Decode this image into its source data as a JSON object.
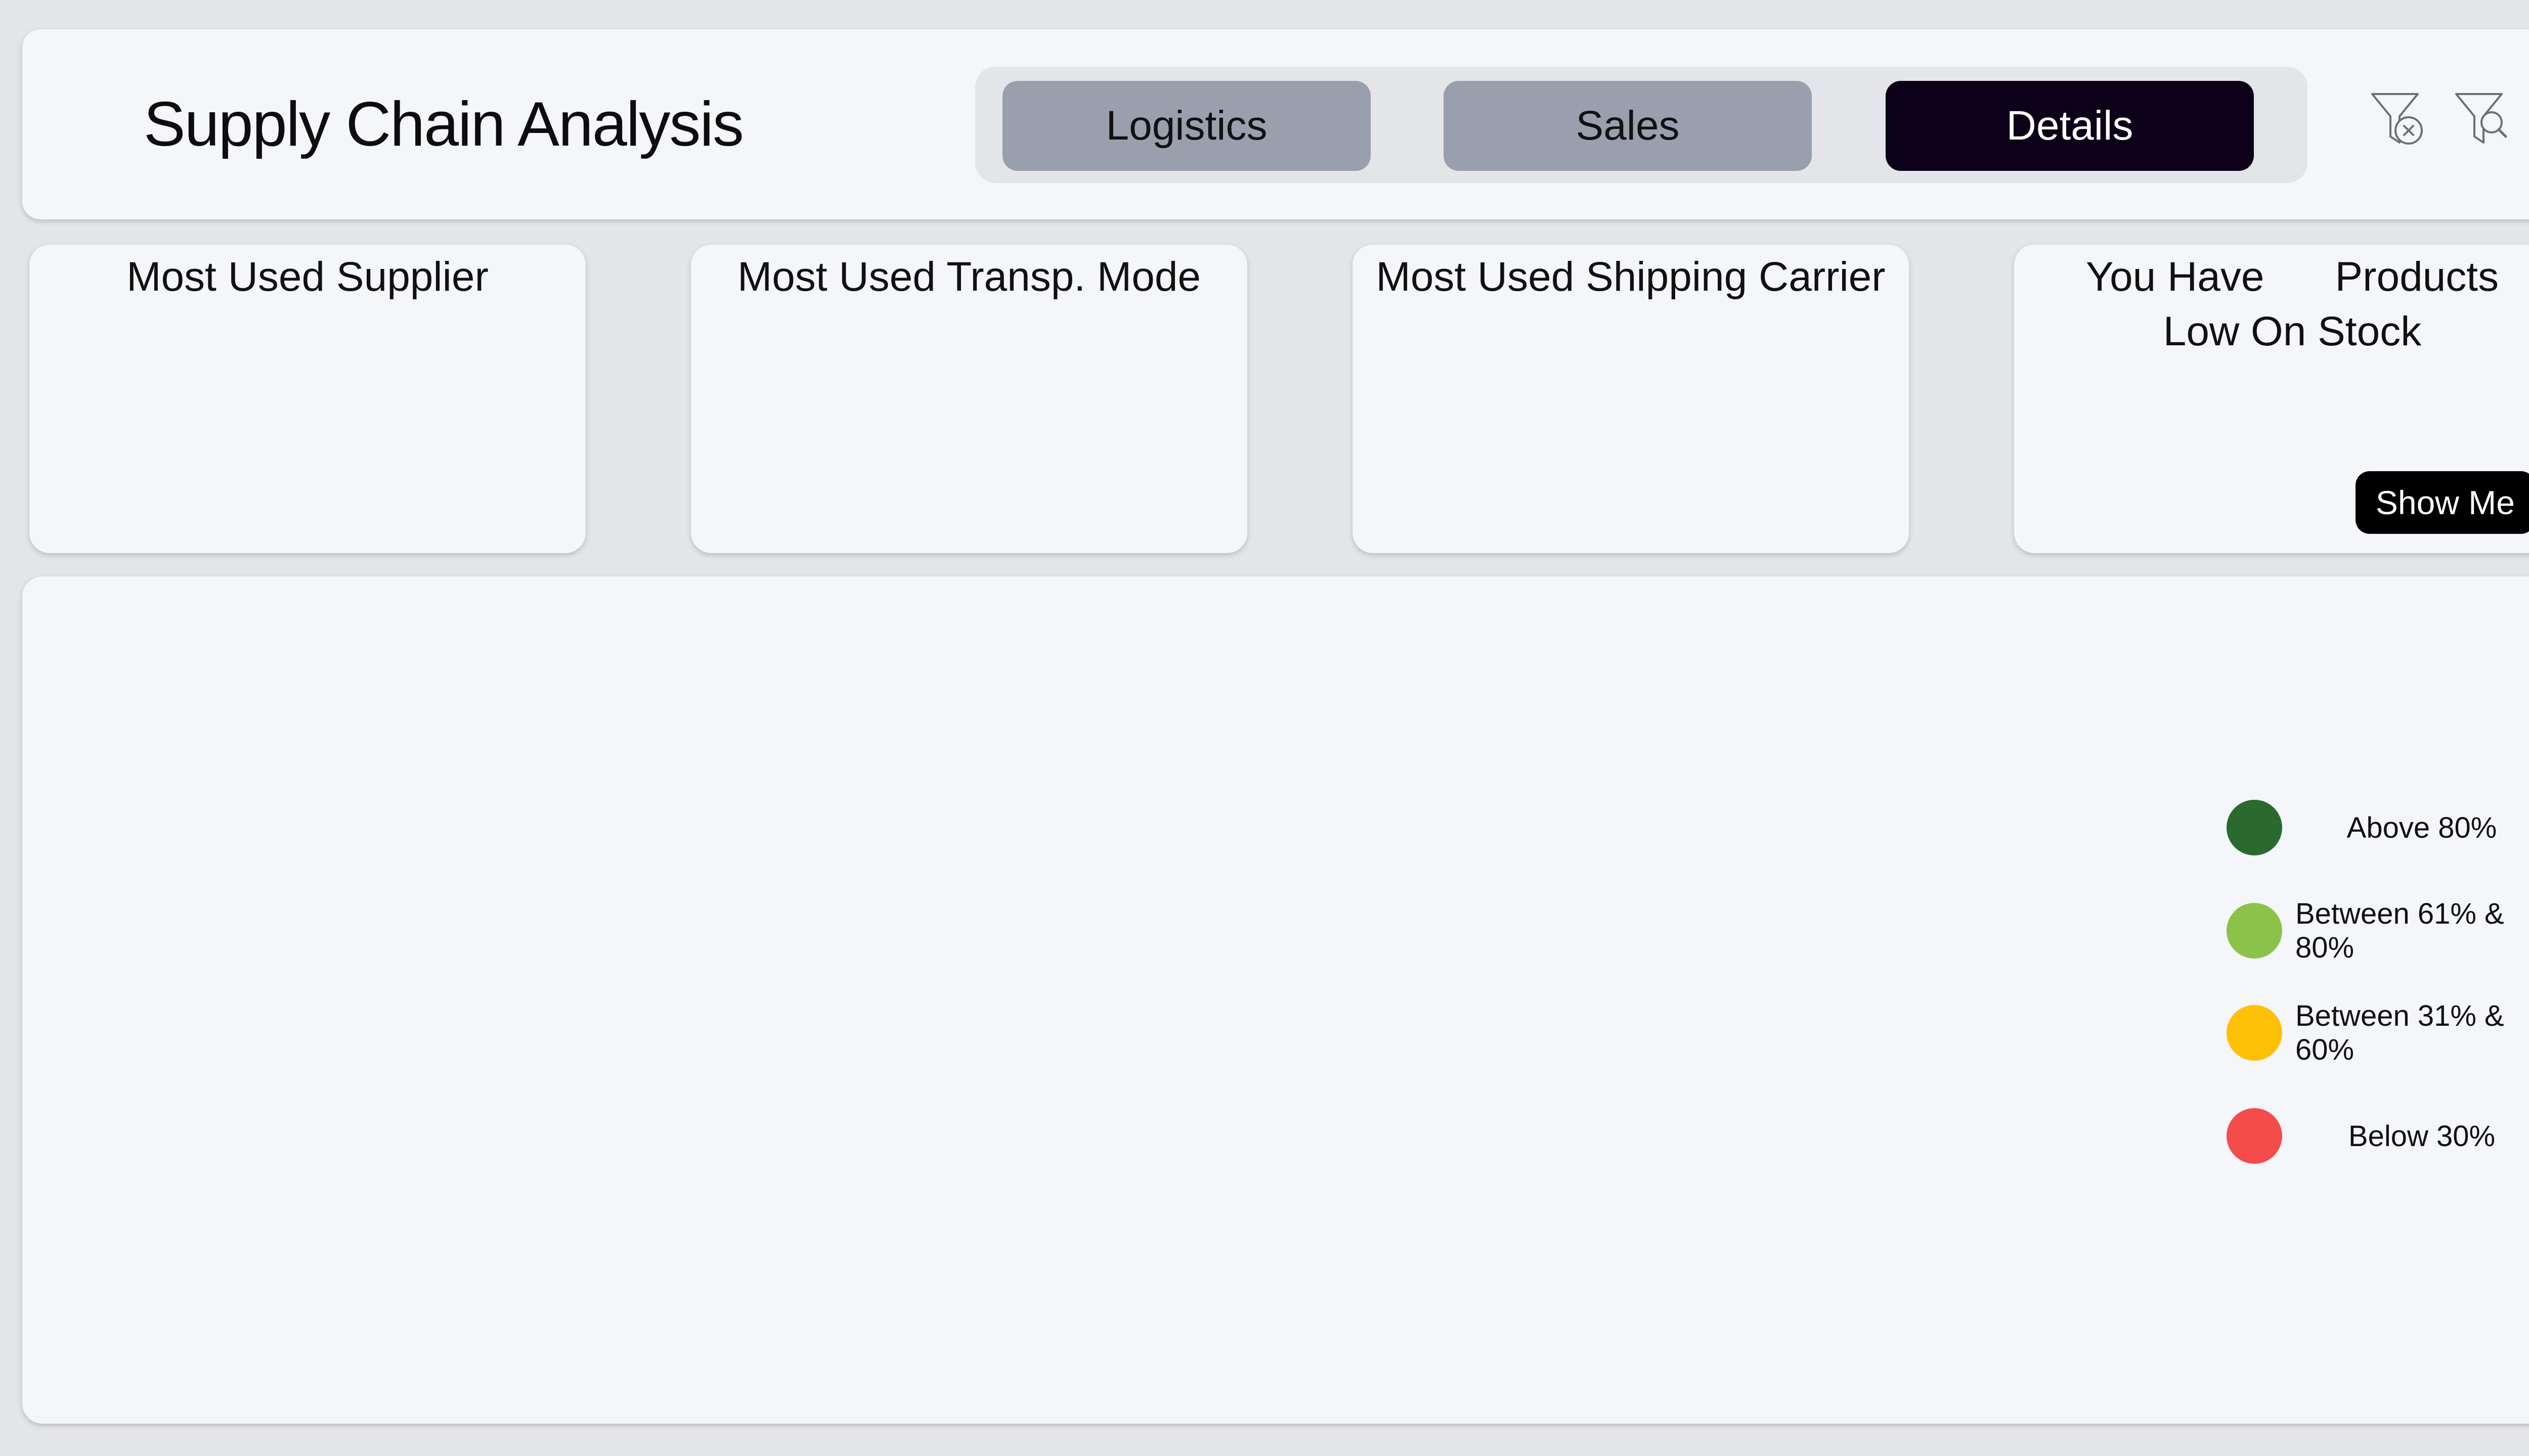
{
  "header": {
    "title": "Supply Chain Analysis",
    "tabs": [
      {
        "label": "Logistics",
        "active": false
      },
      {
        "label": "Sales",
        "active": false
      },
      {
        "label": "Details",
        "active": true
      }
    ],
    "icons": [
      "clear-filter-icon",
      "search-filter-icon"
    ]
  },
  "cards": {
    "supplier": {
      "title": "Most Used Supplier"
    },
    "transport": {
      "title": "Most Used Transp. Mode"
    },
    "carrier": {
      "title": "Most Used Shipping Carrier"
    },
    "low_stock": {
      "title_lead": "You Have",
      "title_rest": "Products Low On Stock",
      "button_label": "Show Me"
    }
  },
  "legend": {
    "items": [
      {
        "label": "Above 80%",
        "color": "#2a6a2e"
      },
      {
        "label": "Between 61% & 80%",
        "color": "#8bc34a"
      },
      {
        "label": "Between 31% & 60%",
        "color": "#ffc107"
      },
      {
        "label": "Below 30%",
        "color": "#f44b4b"
      }
    ]
  },
  "colors": {
    "background": "#e4e5e9",
    "panel": "#f4f6fa",
    "tab_inactive": "#9a9fae",
    "tab_active": "#0c0118"
  }
}
